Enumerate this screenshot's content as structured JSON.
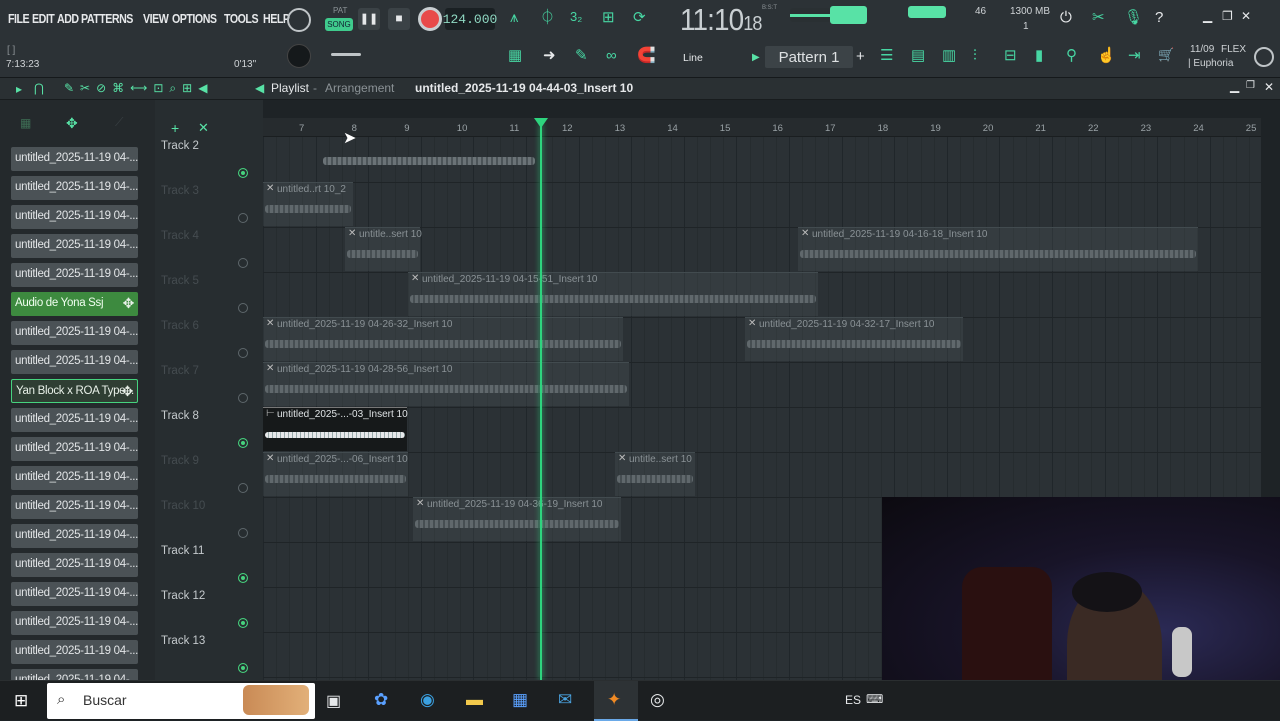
{
  "menu": [
    "FILE",
    "EDIT",
    "ADD",
    "PATTERNS",
    "VIEW",
    "OPTIONS",
    "TOOLS",
    "HELP"
  ],
  "transport": {
    "pat_label": "PAT",
    "song_label": "SONG",
    "tempo": "124.000",
    "time_main": "11:10",
    "time_sub": "18",
    "bst": "B:S:T",
    "song_pos": "7:13:23",
    "song_len": "0'13\"",
    "bracket": "[ ]"
  },
  "monitor": {
    "value": "46",
    "memory": "1300 MB",
    "voices": "1"
  },
  "snap": {
    "mode": "Line"
  },
  "pattern": {
    "label": "Pattern 1"
  },
  "news": {
    "date": "11/09",
    "title": "FLEX",
    "subtitle": "| Euphoria"
  },
  "playlist": {
    "title": "Playlist",
    "sep": " - ",
    "view": "Arrangement",
    "project": "untitled_2025-11-19 04-44-03_Insert 10"
  },
  "browser_items": [
    {
      "label": "untitled_2025-11-19 04-..."
    },
    {
      "label": "untitled_2025-11-19 04-..."
    },
    {
      "label": "untitled_2025-11-19 04-..."
    },
    {
      "label": "untitled_2025-11-19 04-..."
    },
    {
      "label": "untitled_2025-11-19 04-..."
    },
    {
      "label": "Audio de Yona Ssj"
    },
    {
      "label": "untitled_2025-11-19 04-..."
    },
    {
      "label": "untitled_2025-11-19 04-..."
    },
    {
      "label": "Yan Block x ROA Type..."
    },
    {
      "label": "untitled_2025-11-19 04-..."
    },
    {
      "label": "untitled_2025-11-19 04-..."
    },
    {
      "label": "untitled_2025-11-19 04-..."
    },
    {
      "label": "untitled_2025-11-19 04-..."
    },
    {
      "label": "untitled_2025-11-19 04-..."
    },
    {
      "label": "untitled_2025-11-19 04-..."
    },
    {
      "label": "untitled_2025-11-19 04-..."
    },
    {
      "label": "untitled_2025-11-19 04-..."
    },
    {
      "label": "untitled_2025-11-19 04-..."
    },
    {
      "label": "untitled_2025-11-19 04-..."
    }
  ],
  "tracks": [
    "Track 2",
    "Track 3",
    "Track 4",
    "Track 5",
    "Track 6",
    "Track 7",
    "Track 8",
    "Track 9",
    "Track 10",
    "Track 11",
    "Track 12",
    "Track 13"
  ],
  "ruler": [
    "7",
    "8",
    "9",
    "10",
    "11",
    "12",
    "13",
    "14",
    "15",
    "16",
    "17",
    "18",
    "19",
    "20",
    "21",
    "22",
    "23",
    "24",
    "25"
  ],
  "clips": [
    {
      "label": "untitled..rt 10_2"
    },
    {
      "label": "untitle..sert 10"
    },
    {
      "label": "untitled_2025-11-19 04-16-18_Insert 10"
    },
    {
      "label": "untitled_2025-11-19 04-15-51_Insert 10"
    },
    {
      "label": "untitled_2025-11-19 04-26-32_Insert 10"
    },
    {
      "label": "untitled_2025-11-19 04-32-17_Insert 10"
    },
    {
      "label": "untitled_2025-11-19 04-28-56_Insert 10"
    },
    {
      "label": "untitled_2025-...-03_Insert 10"
    },
    {
      "label": "untitled_2025-...-06_Insert 10"
    },
    {
      "label": "untitle..sert 10"
    },
    {
      "label": "untitled_2025-11-19 04-36-19_Insert 10"
    }
  ],
  "taskbar": {
    "search_placeholder": "Buscar",
    "lang": "ES"
  }
}
